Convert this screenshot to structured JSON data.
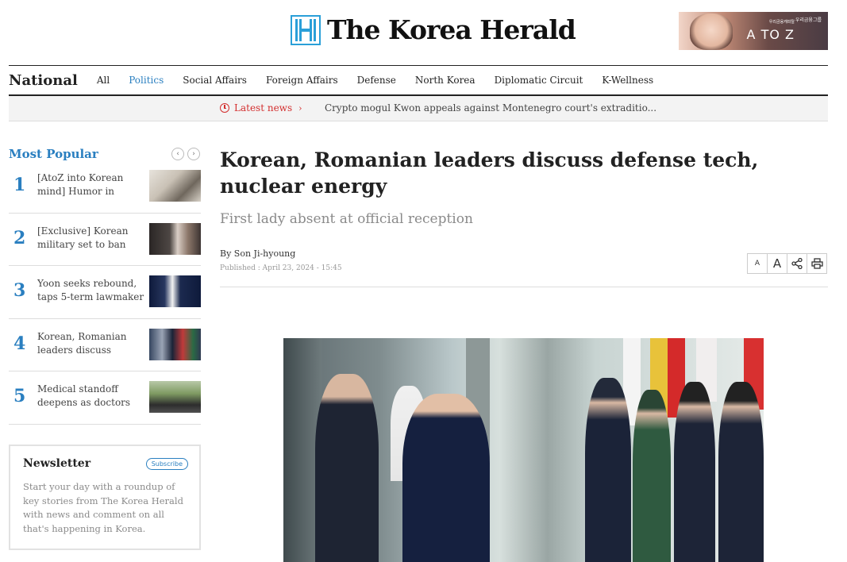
{
  "masthead": {
    "logo_text": "The Korea Herald",
    "ad": {
      "text": "A TO Z",
      "small": "우리금융캐피탈",
      "tag": "우리금융그룹"
    }
  },
  "nav": {
    "section": "National",
    "items": [
      "All",
      "Politics",
      "Social Affairs",
      "Foreign Affairs",
      "Defense",
      "North Korea",
      "Diplomatic Circuit",
      "K-Wellness"
    ],
    "active": "Politics"
  },
  "latest": {
    "label": "Latest news",
    "headline": "Crypto mogul Kwon appeals against Montenegro court's extraditio..."
  },
  "sidebar": {
    "title": "Most Popular",
    "items": [
      {
        "num": "1",
        "text": "[AtoZ into Korean mind] Humor in Korea: Punchlines, Wordplay, and Cultural"
      },
      {
        "num": "2",
        "text": "[Exclusive] Korean military set to ban iPhones over security concerns"
      },
      {
        "num": "3",
        "text": "Yoon seeks rebound, taps 5-term lawmaker as chief of staff"
      },
      {
        "num": "4",
        "text": "Korean, Romanian leaders discuss defense tech, nuclear energy"
      },
      {
        "num": "5",
        "text": "Medical standoff deepens as doctors prepare to leave"
      }
    ],
    "newsletter": {
      "title": "Newsletter",
      "button": "Subscribe",
      "description": "Start your day with a roundup of key stories from The Korea Herald with news and comment on all that's happening in Korea."
    }
  },
  "article": {
    "headline": "Korean, Romanian leaders discuss defense tech, nuclear energy",
    "subheadline": "First lady absent at official reception",
    "byline": "By Son Ji-hyoung",
    "published": "Published : April 23, 2024 - 15:45",
    "tools": {
      "font_small": "A",
      "font_large": "A"
    }
  },
  "colors": {
    "accent": "#2a7fc0",
    "alert": "#d32f2f"
  }
}
